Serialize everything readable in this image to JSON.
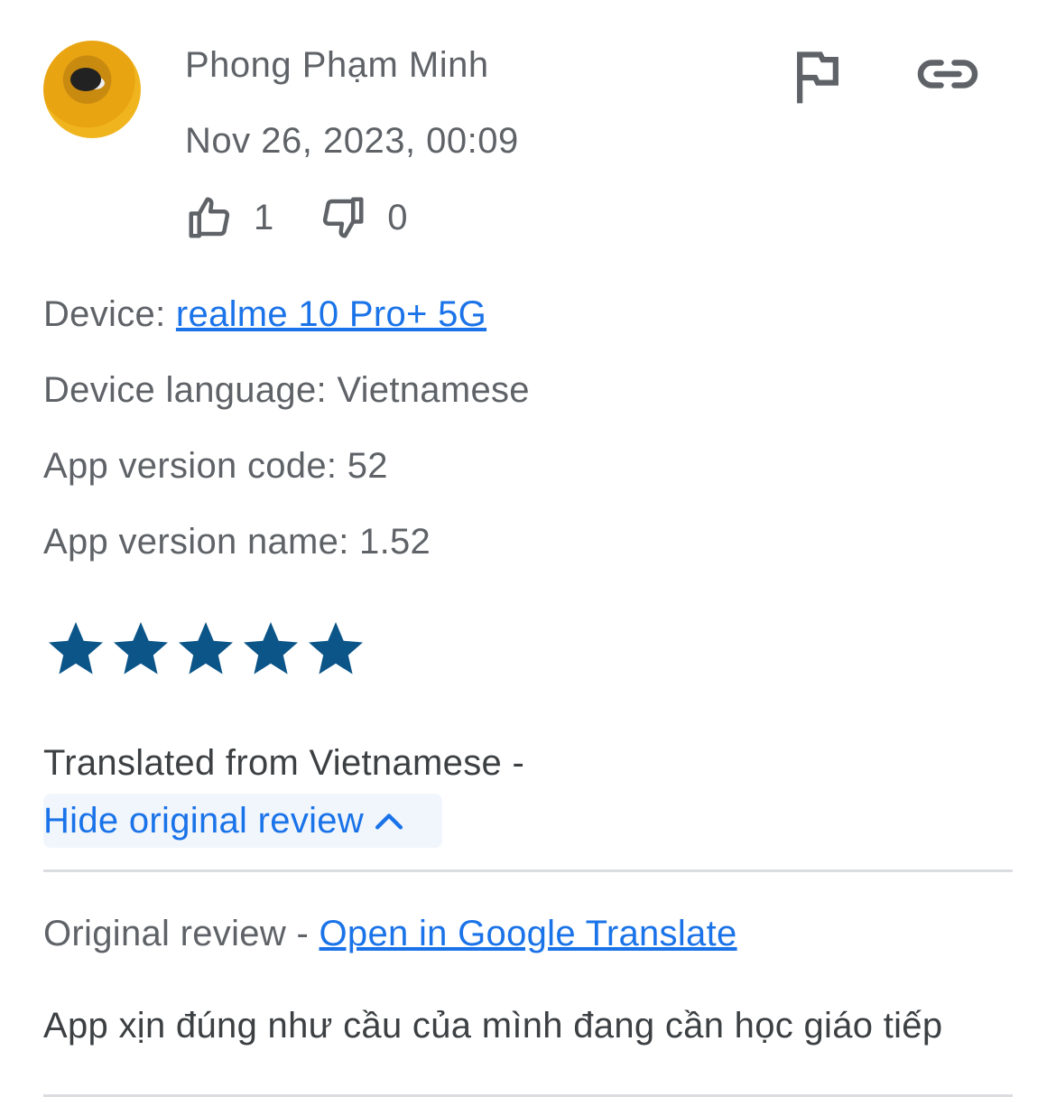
{
  "review": {
    "author": "Phong Phạm Minh",
    "date": "Nov 26, 2023, 00:09",
    "thumbs_up_count": "1",
    "thumbs_down_count": "0",
    "rating": 5,
    "rating_max": 5
  },
  "details": {
    "device_label": "Device:",
    "device_value": "realme 10 Pro+ 5G",
    "language_label": "Device language:",
    "language_value": "Vietnamese",
    "version_code_label": "App version code:",
    "version_code_value": "52",
    "version_name_label": "App version name:",
    "version_name_value": "1.52"
  },
  "translation": {
    "translated_from": "Translated from Vietnamese -",
    "hide_original_label": "Hide original review",
    "original_label": "Original review -",
    "open_translate_label": "Open in Google Translate",
    "original_text": "App xịn đúng như cầu của mình đang cần học giáo tiếp"
  },
  "icons": {
    "flag": "flag-icon",
    "link": "link-icon",
    "thumbs_up": "thumbs-up-icon",
    "thumbs_down": "thumbs-down-icon",
    "star": "star-icon",
    "chevron_up": "chevron-up-icon"
  },
  "colors": {
    "star": "#0b5589",
    "link": "#1a73e8",
    "text": "#5f6368"
  }
}
